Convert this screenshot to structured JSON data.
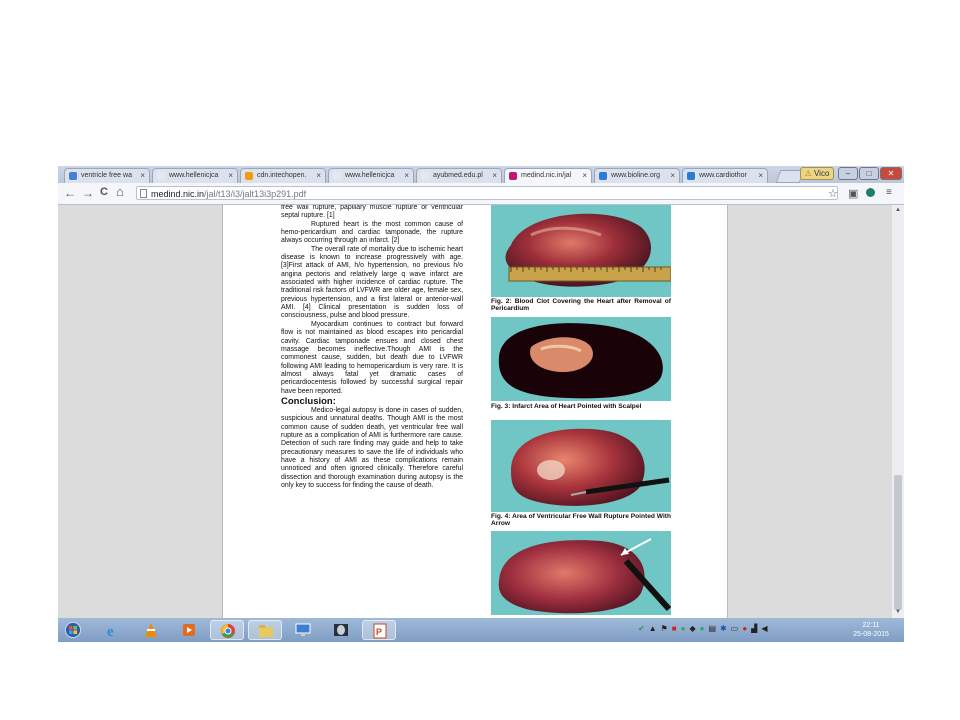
{
  "browser": {
    "tabs": [
      {
        "label": "ventricle free wa",
        "color": "#4a7fd6",
        "active": false
      },
      {
        "label": "www.hellenicjca",
        "color": "#e8e8e8",
        "active": false
      },
      {
        "label": "cdn.intechopen.",
        "color": "#f39c12",
        "active": false
      },
      {
        "label": "www.hellenicjca",
        "color": "#e8e8e8",
        "active": false
      },
      {
        "label": "ayubmed.edu.pl",
        "color": "#e8e8e8",
        "active": false
      },
      {
        "label": "medind.nic.in/jal",
        "color": "#c0157a",
        "active": true
      },
      {
        "label": "www.bioline.org",
        "color": "#2a7bd4",
        "active": false
      },
      {
        "label": "www.cardiothor",
        "color": "#2a7bd4",
        "active": false
      }
    ],
    "tab_close": "×",
    "window_buttons": {
      "user": "Vico",
      "minimize": "–",
      "maximize": "□",
      "close": "✕"
    },
    "nav": {
      "back": "←",
      "forward": "→",
      "reload": "C",
      "home": "⌂"
    },
    "url_host": "medind.nic.in",
    "url_path": "/jal/t13/i3/jalt13i3p291.pdf"
  },
  "document": {
    "paragraphs": [
      "free wall rupture, papillary muscle rupture or ventricular septal rupture. [1]",
      "Ruptured heart is the most common cause of hemo-pericardium and cardiac tamponade, the rupture always occurring through an infarct. [2]",
      "The overall rate of mortality due to ischemic heart disease is known to increase progressively with age. [3]First attack of AMI, h/o hypertension, no previous h/o angina pectoris and relatively large q wave infarct are associated with higher incidence of cardiac rupture. The traditional risk factors of LVFWR are older age, female sex, previous hypertension, and a first lateral or anterior-wall AMI. [4] Clinical presentation is sudden loss of consciousness, pulse and blood pressure.",
      "Myocardium continues to contract but forward flow is not maintained as blood escapes into pericardial cavity. Cardiac tamponade ensues and closed chest massage becomes ineffective.Though AMI is the commonest cause, sudden, but death due to LVFWR following AMI leading to hemopericardium is very rare. It is almost always fatal yet dramatic cases of pericardiocentesis followed by successful surgical repair have been reported."
    ],
    "conclusion_heading": "Conclusion:",
    "conclusion_text": "Medico-legal autopsy is done in cases of sudden, suspicious and unnatural deaths. Though AMI is the most common cause of sudden death, yet ventricular free wall rupture as a complication of AMI is furthermore rare cause. Detection of such rare finding may guide and help to take precautionary measures to save the life of individuals who have a history of AMI as these complications remain unnoticed and often ignored clinically. Therefore careful dissection and thorough examination during autopsy is the only key to success for finding the cause of death.",
    "captions": {
      "fig2": "Fig. 2: Blood Clot Covering the Heart after Removal of Pericardium",
      "fig3": "Fig. 3: Infarct Area of Heart Pointed with Scalpel",
      "fig4": "Fig. 4: Area of Ventricular Free Wall Rupture Pointed With Arrow"
    }
  },
  "taskbar": {
    "apps": [
      "start-orb",
      "internet-explorer",
      "vlc",
      "media-player",
      "chrome",
      "file-explorer",
      "network-app",
      "image-viewer",
      "powerpoint"
    ],
    "clock_time": "22:11",
    "clock_date": "25-08-2015"
  }
}
